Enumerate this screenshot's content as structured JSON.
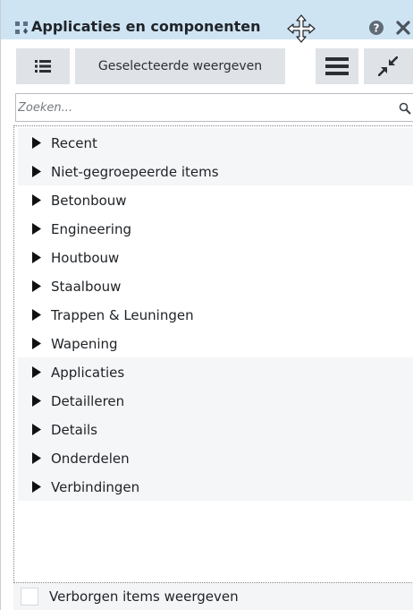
{
  "window": {
    "title": "Applicaties en componenten"
  },
  "toolbar": {
    "show_selected_label": "Geselecteerde weergeven"
  },
  "search": {
    "placeholder": "Zoeken...",
    "value": ""
  },
  "tree": {
    "items": [
      {
        "label": "Recent"
      },
      {
        "label": "Niet-gegroepeerde items"
      },
      {
        "label": "Betonbouw"
      },
      {
        "label": "Engineering"
      },
      {
        "label": "Houtbouw"
      },
      {
        "label": "Staalbouw"
      },
      {
        "label": "Trappen & Leuningen"
      },
      {
        "label": "Wapening"
      },
      {
        "label": "Applicaties"
      },
      {
        "label": "Detailleren"
      },
      {
        "label": "Details"
      },
      {
        "label": "Onderdelen"
      },
      {
        "label": "Verbindingen"
      }
    ]
  },
  "footer": {
    "show_hidden_label": "Verborgen items weergeven",
    "show_hidden_checked": false
  },
  "icons": {
    "title_drag": "drag-handle-icon",
    "move": "move-arrows-icon",
    "help": "help-icon",
    "close": "close-icon",
    "list": "list-icon",
    "menu": "hamburger-menu-icon",
    "collapse": "collapse-arrows-icon",
    "search": "search-icon",
    "expand": "expand-triangle-icon"
  },
  "colors": {
    "title_bar": "#cfe4f3",
    "toolbar_button": "#dfe2e6",
    "row_shade": "#f5f6f8"
  }
}
